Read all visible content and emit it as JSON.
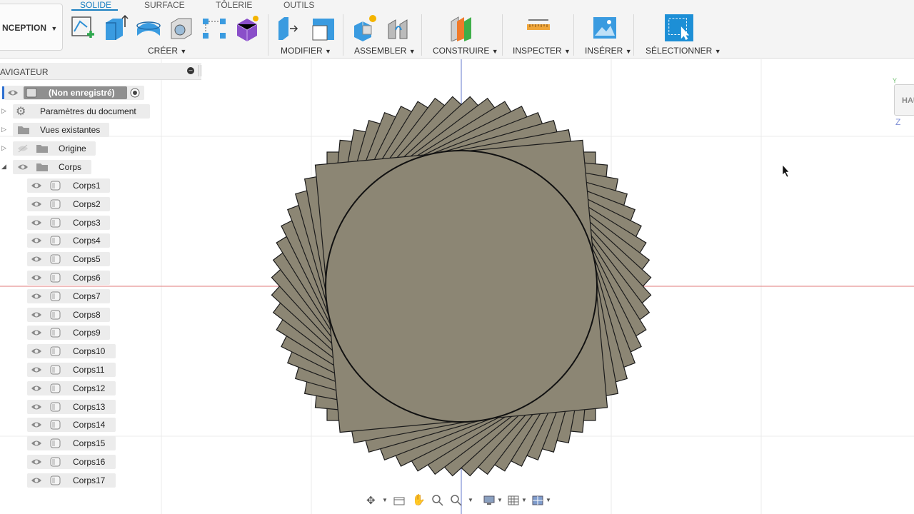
{
  "workspace": {
    "label": "NCEPTION"
  },
  "tabs": [
    {
      "label": "SOLIDE",
      "active": true
    },
    {
      "label": "SURFACE",
      "active": false
    },
    {
      "label": "TÔLERIE",
      "active": false
    },
    {
      "label": "OUTILS",
      "active": false
    }
  ],
  "toolbar": {
    "groups": [
      {
        "label": "CRÉER"
      },
      {
        "label": "MODIFIER"
      },
      {
        "label": "ASSEMBLER"
      },
      {
        "label": "CONSTRUIRE"
      },
      {
        "label": "INSPECTER"
      },
      {
        "label": "INSÉRER"
      },
      {
        "label": "SÉLECTIONNER"
      }
    ]
  },
  "navigator": {
    "title": "AVIGATEUR",
    "root_label": "(Non enregistré)",
    "items": [
      {
        "label": "Paramètres du document"
      },
      {
        "label": "Vues existantes"
      },
      {
        "label": "Origine"
      },
      {
        "label": "Corps"
      }
    ],
    "bodies": [
      "Corps1",
      "Corps2",
      "Corps3",
      "Corps4",
      "Corps5",
      "Corps6",
      "Corps7",
      "Corps8",
      "Corps9",
      "Corps10",
      "Corps11",
      "Corps12",
      "Corps13",
      "Corps14",
      "Corps15",
      "Corps16",
      "Corps17"
    ]
  },
  "viewcube": {
    "label": "HAU",
    "axis_z": "Z",
    "axis_y": "Y"
  },
  "colors": {
    "accent": "#1a7fc1",
    "body_fill": "#8c8674",
    "x_axis": "#e07b7b",
    "y_axis": "#7f8fd6"
  }
}
